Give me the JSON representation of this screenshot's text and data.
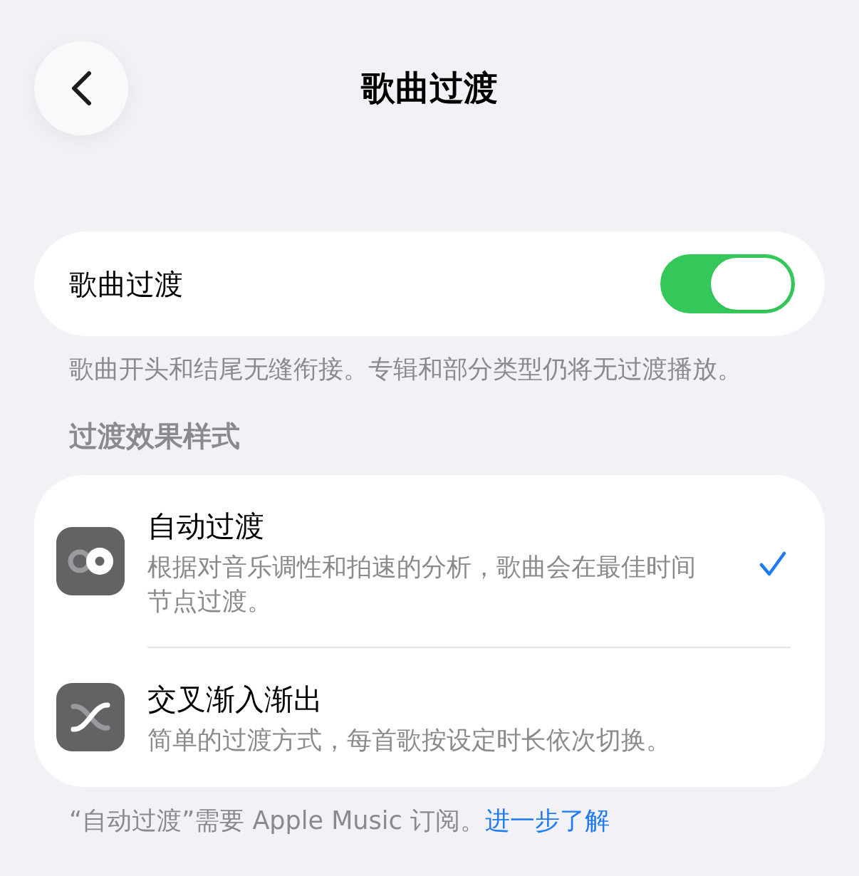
{
  "header": {
    "title": "歌曲过渡"
  },
  "toggle_card": {
    "label": "歌曲过渡",
    "on": true
  },
  "toggle_footer": "歌曲开头和结尾无缝衔接。专辑和部分类型仍将无过渡播放。",
  "section_header": "过渡效果样式",
  "styles": [
    {
      "kind": "auto",
      "title": "自动过渡",
      "description": "根据对音乐调性和拍速的分析，歌曲会在最佳时间节点过渡。",
      "selected": true
    },
    {
      "kind": "crossfade",
      "title": "交叉渐入渐出",
      "description": "简单的过渡方式，每首歌按设定时长依次切换。",
      "selected": false
    }
  ],
  "note": {
    "text": "“自动过渡”需要 Apple Music 订阅。",
    "link": "进一步了解"
  }
}
